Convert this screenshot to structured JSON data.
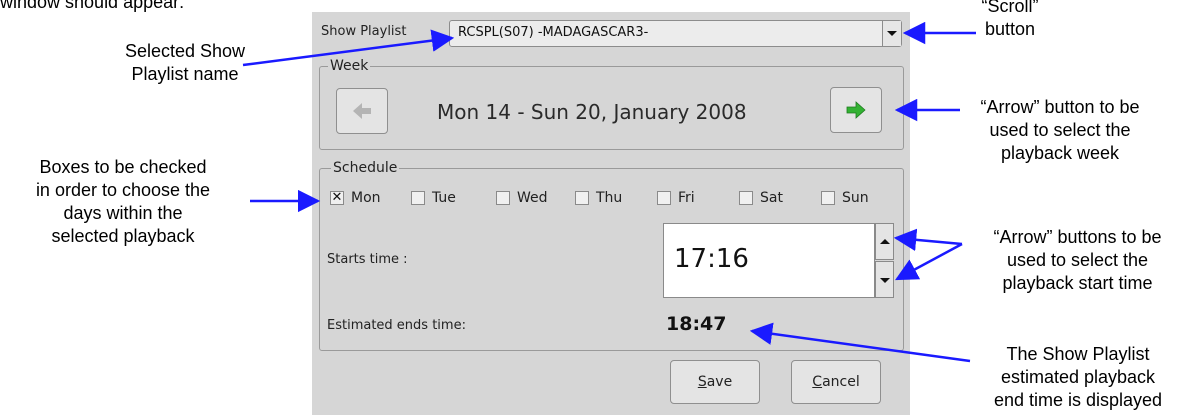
{
  "intro_text_fragment": "window should appear:",
  "callouts": {
    "scroll_button": [
      "“Scroll”",
      "button"
    ],
    "selected_playlist": [
      "Selected Show",
      "Playlist name"
    ],
    "arrow_week": [
      "“Arrow” button to be",
      "used to select the",
      "playback week"
    ],
    "checkboxes": [
      "Boxes to be checked",
      "in order to choose the",
      "days within the",
      "selected playback"
    ],
    "arrow_time": [
      "“Arrow” buttons to be",
      "used to select the",
      "playback start time"
    ],
    "end_time": [
      "The Show Playlist",
      "estimated playback",
      "end time is displayed"
    ]
  },
  "dialog": {
    "playlist_label": "Show Playlist",
    "playlist_value": "RCSPL(S07) -MADAGASCAR3-",
    "week_group_label": "Week",
    "week_range": "Mon 14 - Sun 20, January 2008",
    "schedule_group_label": "Schedule",
    "days": [
      {
        "label": "Mon",
        "checked": true
      },
      {
        "label": "Tue",
        "checked": false
      },
      {
        "label": "Wed",
        "checked": false
      },
      {
        "label": "Thu",
        "checked": false
      },
      {
        "label": "Fri",
        "checked": false
      },
      {
        "label": "Sat",
        "checked": false
      },
      {
        "label": "Sun",
        "checked": false
      }
    ],
    "starts_time_label": "Starts time :",
    "starts_time_value": "17:16",
    "estimated_end_label": "Estimated ends time:",
    "estimated_end_value": "18:47",
    "save_mnemonic": "S",
    "save_rest": "ave",
    "cancel_mnemonic": "C",
    "cancel_rest": "ancel"
  },
  "icons": {
    "prev_week": "left-arrow-icon",
    "next_week": "right-arrow-icon",
    "dropdown": "chevron-down-icon"
  },
  "colors": {
    "panel_bg": "#d6d6d6",
    "callout_arrow": "#1a1aff",
    "next_arrow_green": "#33b233",
    "prev_arrow_disabled": "#b4b4b4"
  }
}
